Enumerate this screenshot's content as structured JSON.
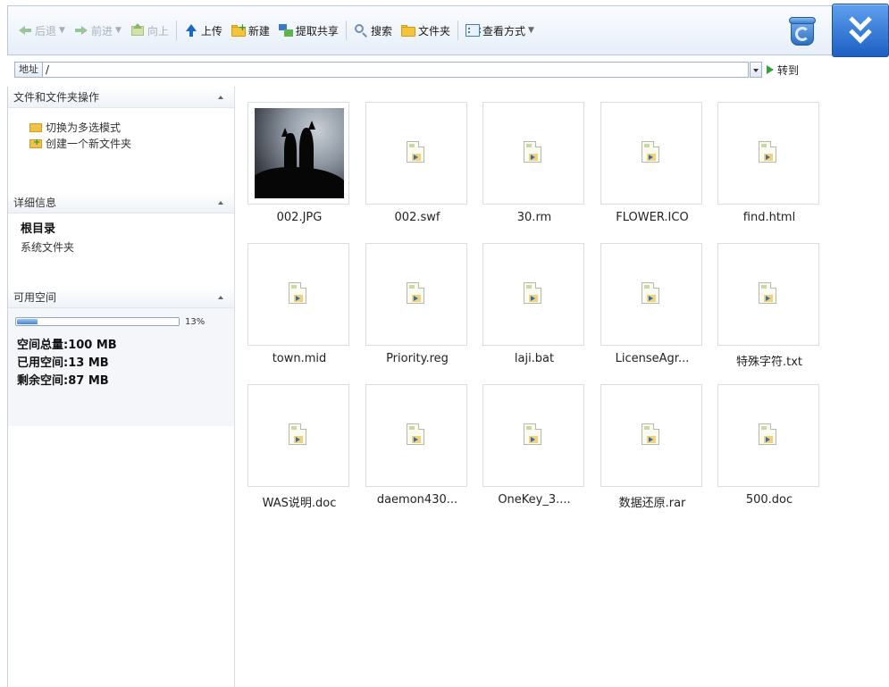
{
  "toolbar": {
    "back": "后退",
    "forward": "前进",
    "up": "向上",
    "upload": "上传",
    "new": "新建",
    "share": "提取共享",
    "search": "搜索",
    "folder": "文件夹",
    "view": "查看方式"
  },
  "address": {
    "label": "地址",
    "value": "/",
    "go": "转到"
  },
  "sidebar": {
    "ops": {
      "title": "文件和文件夹操作",
      "items": [
        "切换为多选模式",
        "创建一个新文件夹"
      ]
    },
    "detail": {
      "title": "详细信息",
      "name": "根目录",
      "type": "系统文件夹"
    },
    "space": {
      "title": "可用空间",
      "percent_label": "13%",
      "used_fraction": 0.13,
      "total": "空间总量:100 MB",
      "used": "已用空间:13 MB",
      "free": "剩余空间:87 MB"
    }
  },
  "files": [
    {
      "name": "002.JPG",
      "kind": "image"
    },
    {
      "name": "002.swf",
      "kind": "doc"
    },
    {
      "name": "30.rm",
      "kind": "doc"
    },
    {
      "name": "FLOWER.ICO",
      "kind": "doc"
    },
    {
      "name": "find.html",
      "kind": "doc"
    },
    {
      "name": "town.mid",
      "kind": "doc"
    },
    {
      "name": "Priority.reg",
      "kind": "doc"
    },
    {
      "name": "laji.bat",
      "kind": "doc"
    },
    {
      "name": "LicenseAgr...",
      "kind": "doc"
    },
    {
      "name": "特殊字符.txt",
      "kind": "doc"
    },
    {
      "name": "WAS说明.doc",
      "kind": "doc"
    },
    {
      "name": "daemon430...",
      "kind": "doc"
    },
    {
      "name": "OneKey_3....",
      "kind": "doc"
    },
    {
      "name": "数据还原.rar",
      "kind": "doc"
    },
    {
      "name": "500.doc",
      "kind": "doc"
    }
  ]
}
